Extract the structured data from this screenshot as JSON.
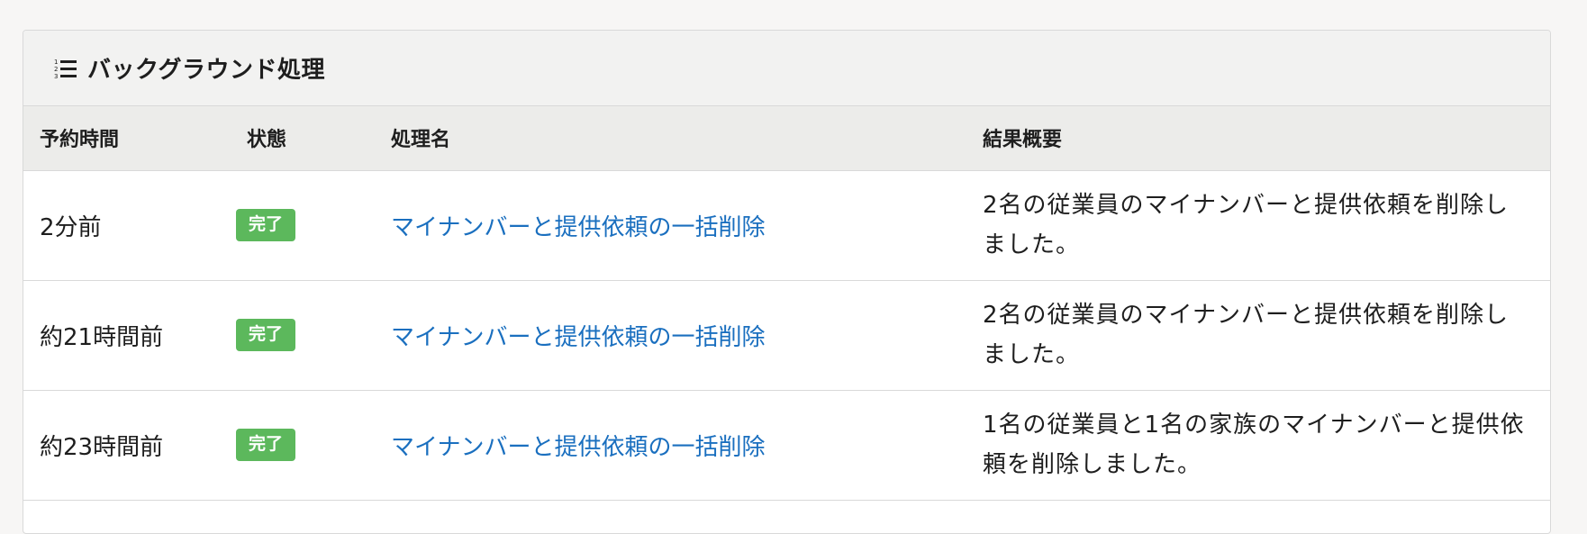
{
  "panel": {
    "title": "バックグラウンド処理",
    "icon": "numbered-list-icon"
  },
  "table": {
    "headers": {
      "time": "予約時間",
      "status": "状態",
      "name": "処理名",
      "result": "結果概要"
    },
    "rows": [
      {
        "time": "2分前",
        "status": "完了",
        "name": "マイナンバーと提供依頼の一括削除",
        "result": "2名の従業員のマイナンバーと提供依頼を削除しました。"
      },
      {
        "time": "約21時間前",
        "status": "完了",
        "name": "マイナンバーと提供依頼の一括削除",
        "result": "2名の従業員のマイナンバーと提供依頼を削除しました。"
      },
      {
        "time": "約23時間前",
        "status": "完了",
        "name": "マイナンバーと提供依頼の一括削除",
        "result": "1名の従業員と1名の家族のマイナンバーと提供依頼を削除しました。"
      }
    ]
  },
  "colors": {
    "status_complete": "#5cb85c",
    "link": "#1a6fbf"
  }
}
